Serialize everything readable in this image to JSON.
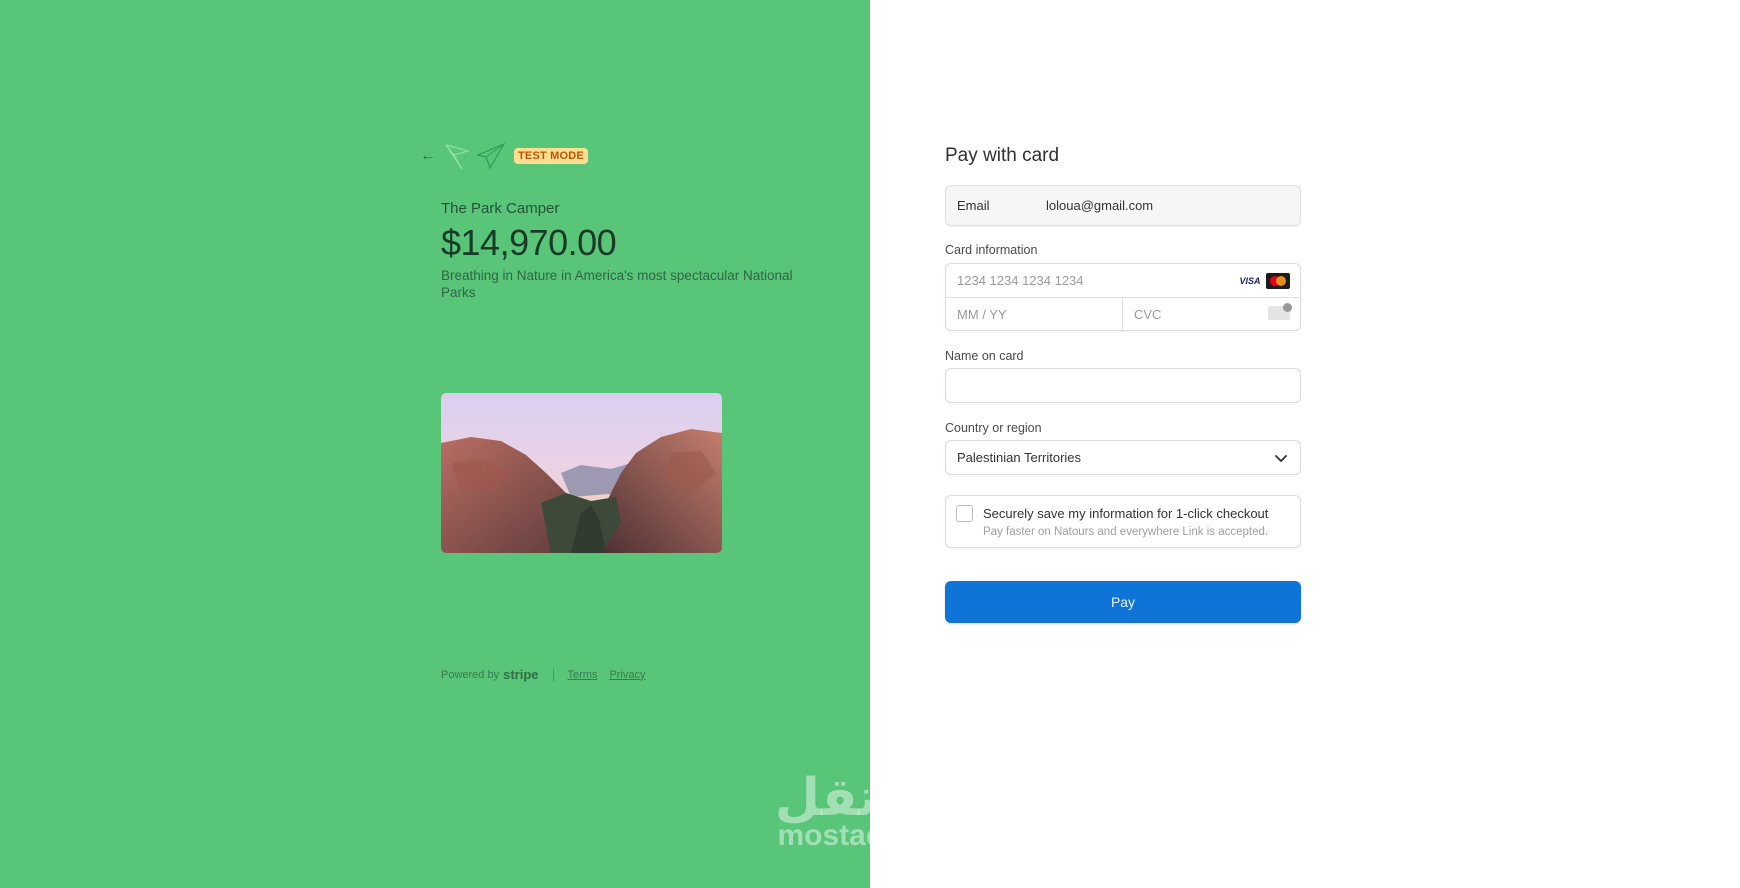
{
  "colors": {
    "left_background": "#58c579",
    "test_badge_bg": "#ffde92",
    "pay_button": "#0e74d8"
  },
  "header": {
    "back_icon": "arrow-left-icon",
    "logo_icon": "paper-plane-logo",
    "test_mode_label": "TEST MODE"
  },
  "product": {
    "name": "The Park Camper",
    "price": "$14,970.00",
    "description": "Breathing in Nature in America's most spectacular National Parks",
    "image_icon": "canyon-landscape-image"
  },
  "footer": {
    "powered_by": "Powered by",
    "brand": "stripe",
    "terms": "Terms",
    "privacy": "Privacy"
  },
  "watermark": {
    "arabic": "مستقل",
    "latin": "mostaql.com"
  },
  "form": {
    "title": "Pay with card",
    "email_label": "Email",
    "email_value": "loloua@gmail.com",
    "card_info_label": "Card information",
    "card_number_placeholder": "1234 1234 1234 1234",
    "visa_label": "VISA",
    "expiry_placeholder": "MM / YY",
    "cvc_placeholder": "CVC",
    "name_label": "Name on card",
    "name_value": "",
    "country_label": "Country or region",
    "country_value": "Palestinian Territories",
    "save_title": "Securely save my information for 1-click checkout",
    "save_subtitle": "Pay faster on Natours and everywhere Link is accepted.",
    "save_checked": false,
    "pay_label": "Pay"
  }
}
